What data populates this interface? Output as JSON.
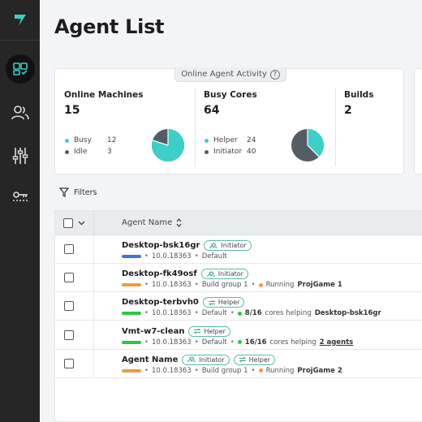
{
  "colors": {
    "accent": "#3ccfc8",
    "busy": "#3ccfc8",
    "idle": "#555c66",
    "bar_blue": "#3b78d6",
    "bar_orange": "#f29a3c",
    "bar_green": "#28c840"
  },
  "sidebar": {
    "logo_icon": "brand-logo-icon",
    "items": [
      {
        "icon": "agents-icon",
        "active": true
      },
      {
        "icon": "users-icon",
        "active": false
      },
      {
        "icon": "sliders-icon",
        "active": false
      },
      {
        "icon": "key-icon",
        "active": false
      }
    ]
  },
  "page_title": "Agent List",
  "activity": {
    "tab_label": "Online Agent Activity",
    "info_glyph": "?",
    "machines": {
      "title": "Online Machines",
      "value": "15",
      "legend": [
        {
          "label": "Busy",
          "value": "12"
        },
        {
          "label": "Idle",
          "value": "3"
        }
      ],
      "pie_busy_fraction": 0.8
    },
    "cores": {
      "title": "Busy Cores",
      "value": "64",
      "legend": [
        {
          "label": "Helper",
          "value": "24"
        },
        {
          "label": "Initiator",
          "value": "40"
        }
      ],
      "pie_helper_fraction": 0.375
    },
    "builds": {
      "title": "Builds",
      "value": "2"
    }
  },
  "filters": {
    "label": "Filters"
  },
  "table": {
    "header": {
      "name_label": "Agent Name"
    },
    "rows": [
      {
        "name": "Desktop-bsk16gr",
        "badges": [
          "Initiator"
        ],
        "version": "10.0.18363",
        "group": "Default",
        "bar_color": "#3b78d6",
        "status_color": "",
        "status_parts": []
      },
      {
        "name": "Desktop-fk49osf",
        "badges": [
          "Initiator"
        ],
        "version": "10.0.18363",
        "group": "Build group 1",
        "bar_color": "#f29a3c",
        "status_color": "#f29a3c",
        "status_parts": [
          "Running",
          "ProjGame 1"
        ]
      },
      {
        "name": "Desktop-terbvh0",
        "badges": [
          "Helper"
        ],
        "version": "10.0.18363",
        "group": "Default",
        "bar_color": "#28c840",
        "status_color": "#28c840",
        "status_parts": [
          "8/16",
          "cores helping",
          "Desktop-bsk16gr"
        ]
      },
      {
        "name": "Vmt-w7-clean",
        "badges": [
          "Helper"
        ],
        "version": "10.0.18363",
        "group": "Default",
        "bar_color": "#28c840",
        "status_color": "#28c840",
        "status_parts": [
          "16/16",
          "cores helping",
          "2 agents"
        ]
      },
      {
        "name": "Agent Name",
        "badges": [
          "Initiator",
          "Helper"
        ],
        "version": "10.0.18363",
        "group": "Build group 1",
        "bar_color": "#f29a3c",
        "status_color": "#f29a3c",
        "status_parts": [
          "Running",
          "ProjGame 2"
        ]
      }
    ]
  }
}
